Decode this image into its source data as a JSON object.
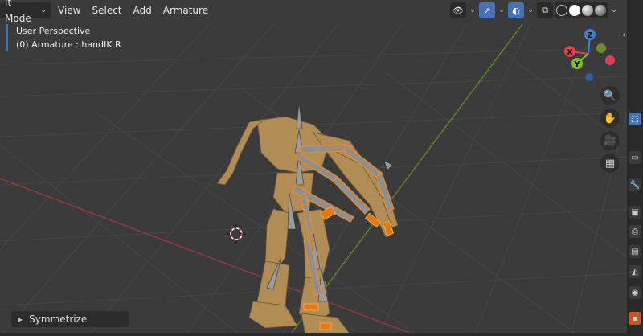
{
  "header": {
    "mode_label": "it Mode",
    "menus": [
      "View",
      "Select",
      "Add",
      "Armature"
    ]
  },
  "overlay": {
    "line1": "User Perspective",
    "line2": "(0) Armature : handIK.R"
  },
  "gizmo": {
    "z": "Z",
    "x": "X",
    "y": "Y"
  },
  "panel": {
    "symmetrize_label": "Symmetrize"
  },
  "colors": {
    "accent": "#4772b3",
    "x_axis": "#e0404f",
    "y_axis": "#7fbf2a",
    "z_axis": "#3b82e0",
    "mesh": "#b8955a",
    "bone_select": "#f28a1e"
  },
  "icons": {
    "viewport_shading": [
      "wireframe-icon",
      "solid-icon",
      "material-icon",
      "rendered-icon"
    ],
    "nav": [
      "zoom-icon",
      "hand-icon",
      "camera-icon",
      "grid-icon"
    ]
  }
}
